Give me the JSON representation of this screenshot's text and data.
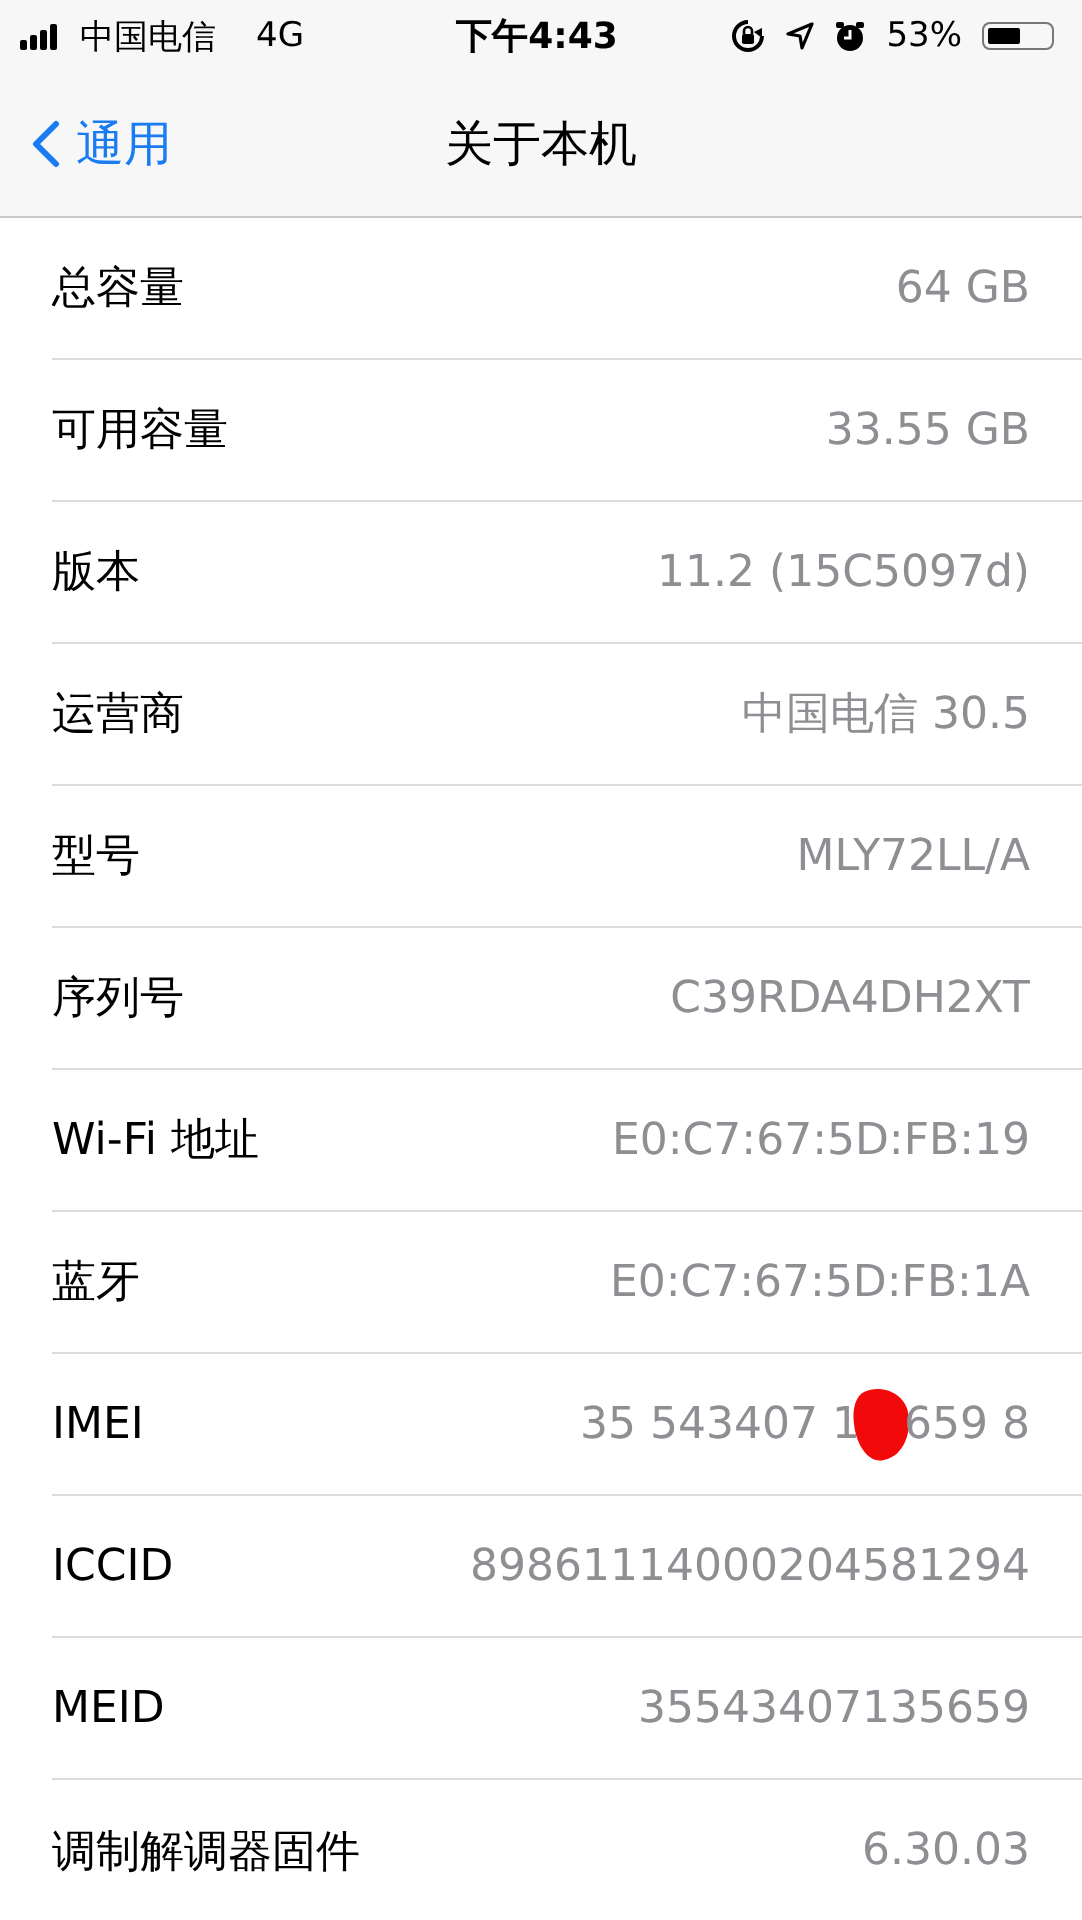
{
  "status_bar": {
    "carrier": "中国电信",
    "network": "4G",
    "time": "下午4:43",
    "battery_percent": "53%",
    "battery": {
      "level": 0.53
    }
  },
  "nav": {
    "back": "通用",
    "title": "关于本机"
  },
  "rows": [
    {
      "kind": "plain",
      "label": "总容量",
      "value": "64 GB"
    },
    {
      "kind": "plain",
      "label": "可用容量",
      "value": "33.55 GB"
    },
    {
      "kind": "plain",
      "label": "版本",
      "value": "11.2 (15C5097d)"
    },
    {
      "kind": "plain",
      "label": "运营商",
      "value": "中国电信 30.5"
    },
    {
      "kind": "plain",
      "label": "型号",
      "value": "MLY72LL/A"
    },
    {
      "kind": "plain",
      "label": "序列号",
      "value": "C39RDA4DH2XT"
    },
    {
      "kind": "plain",
      "label": "Wi-Fi 地址",
      "value": "E0:C7:67:5D:FB:19"
    },
    {
      "kind": "plain",
      "label": "蓝牙",
      "value": "E0:C7:67:5D:FB:1A"
    },
    {
      "kind": "redacted",
      "label": "IMEI",
      "value_start": "35 543407 1",
      "value_end": "659 8"
    },
    {
      "kind": "plain",
      "label": "ICCID",
      "value": "89861114000204581294"
    },
    {
      "kind": "plain",
      "label": "MEID",
      "value": "35543407135659"
    },
    {
      "kind": "plain",
      "label": "调制解调器固件",
      "value": "6.30.03"
    }
  ]
}
